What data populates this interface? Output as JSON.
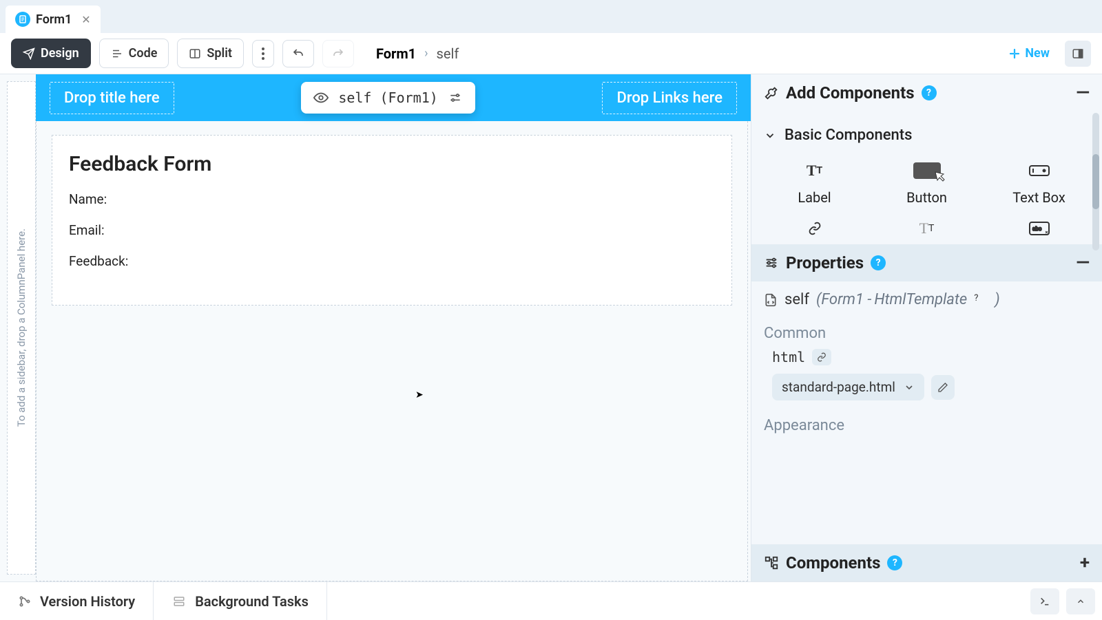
{
  "tab": {
    "label": "Form1"
  },
  "toolbar": {
    "design": "Design",
    "code": "Code",
    "split": "Split",
    "new": "New"
  },
  "breadcrumb": {
    "root": "Form1",
    "leaf": "self"
  },
  "canvas": {
    "drop_title": "Drop title here",
    "drop_links": "Drop Links here",
    "selection_chip": "self (Form1)",
    "sidebar_hint": "To add a sidebar, drop a ColumnPanel here.",
    "form": {
      "title": "Feedback Form",
      "rows": [
        "Name:",
        "Email:",
        "Feedback:"
      ]
    }
  },
  "right_panel": {
    "add_components": "Add Components",
    "basic_components": "Basic Components",
    "components_row1": [
      "Label",
      "Button",
      "Text Box"
    ],
    "properties": "Properties",
    "selected_name": "self",
    "selected_type_open": "(Form1 - ",
    "selected_template": "HtmlTemplate",
    "selected_type_close": ")",
    "group_common": "Common",
    "prop_html_name": "html",
    "prop_html_value": "standard-page.html",
    "group_appearance": "Appearance",
    "components_section": "Components"
  },
  "bottom": {
    "version_history": "Version History",
    "background_tasks": "Background Tasks"
  }
}
